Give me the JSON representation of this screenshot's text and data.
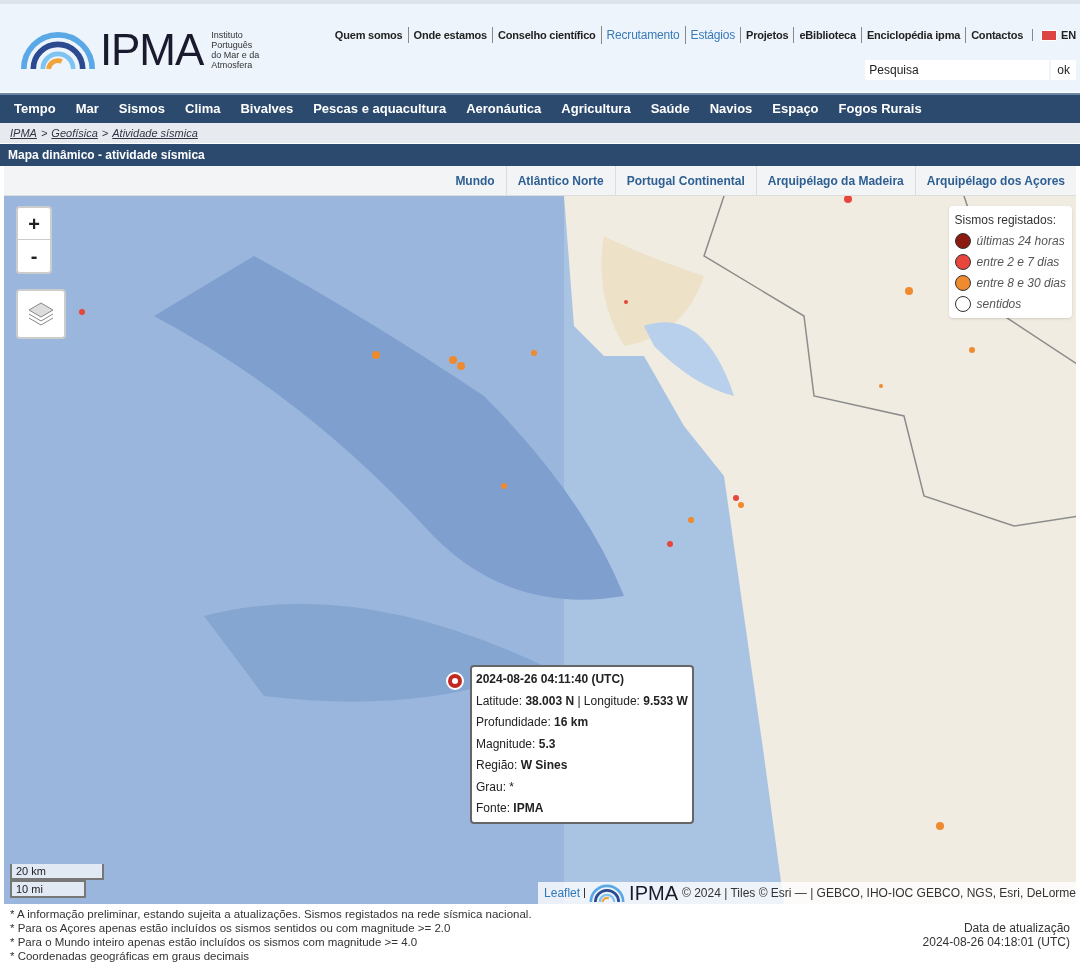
{
  "header": {
    "logo_text": "IPMA",
    "institute_lines": [
      "Instituto",
      "Português",
      "do Mar e da",
      "Atmosfera"
    ],
    "top_links": [
      {
        "label": "Quem somos",
        "highlight": false
      },
      {
        "label": "Onde estamos",
        "highlight": false
      },
      {
        "label": "Conselho científico",
        "highlight": false
      },
      {
        "label": "Recrutamento",
        "highlight": true
      },
      {
        "label": "Estágios",
        "highlight": true
      },
      {
        "label": "Projetos",
        "highlight": false
      },
      {
        "label": "eBiblioteca",
        "highlight": false
      },
      {
        "label": "Enciclopédia **ipma**",
        "highlight": false
      },
      {
        "label": "Contactos",
        "highlight": false
      }
    ],
    "language": "EN",
    "search": {
      "placeholder": "Pesquisa",
      "button": "ok"
    }
  },
  "nav": [
    "Tempo",
    "Mar",
    "Sismos",
    "Clima",
    "Bivalves",
    "Pescas e aquacultura",
    "Aeronáutica",
    "Agricultura",
    "Saúde",
    "Navios",
    "Espaço",
    "Fogos Rurais"
  ],
  "breadcrumb": [
    {
      "label": "IPMA"
    },
    {
      "separator": ">",
      "label": "Geofísica"
    },
    {
      "separator": ">",
      "label": "Atividade sísmica"
    }
  ],
  "section_title": "Mapa dinâmico - atividade sísmica",
  "region_tabs": [
    "Mundo",
    "Atlântico Norte",
    "Portugal Continental",
    "Arquipélago da Madeira",
    "Arquipélago dos Açores"
  ],
  "map": {
    "zoom_in": "+",
    "zoom_out": "-",
    "legend": {
      "title": "Sismos registados:",
      "items": [
        {
          "label": "últimas 24 horas",
          "color": "#8b1a10"
        },
        {
          "label": "entre 2 e 7 dias",
          "color": "#e8453c"
        },
        {
          "label": "entre 8 e 30 dias",
          "color": "#ef8a2e"
        },
        {
          "label": "sentidos",
          "color": "#ffffff"
        }
      ]
    },
    "popup": [
      "**2024-08-26 04:11:40 (UTC)**",
      "Latitude: **38.003 N** | Longitude: **9.533 W**",
      "Profundidade: **16 km**",
      "Magnitude: **5.3**",
      "Região: **W Sines**",
      "Grau: *",
      "Fonte: **IPMA**"
    ],
    "scale": [
      "20 km",
      "10 mi"
    ],
    "attribution": {
      "link": "Leaflet",
      "logo_text": "IPMA",
      "text": "© 2024 | Tiles © Esri — | GEBCO, IHO-IOC GEBCO, NGS, Esri, DeLorme"
    }
  },
  "notes": [
    "* A informação preliminar, estando sujeita a atualizações. Sismos registados na rede sísmica nacional.",
    "* Para os Açores apenas estão incluídos os sismos sentidos ou com magnitude >= 2.0",
    "* Para o Mundo inteiro apenas estão incluídos os sismos com magnitude >= 4.0",
    "* Coordenadas geográficas em graus decimais"
  ],
  "update": {
    "label": "Data de atualização",
    "value": "2024-08-26 04:18:01 (UTC)"
  }
}
